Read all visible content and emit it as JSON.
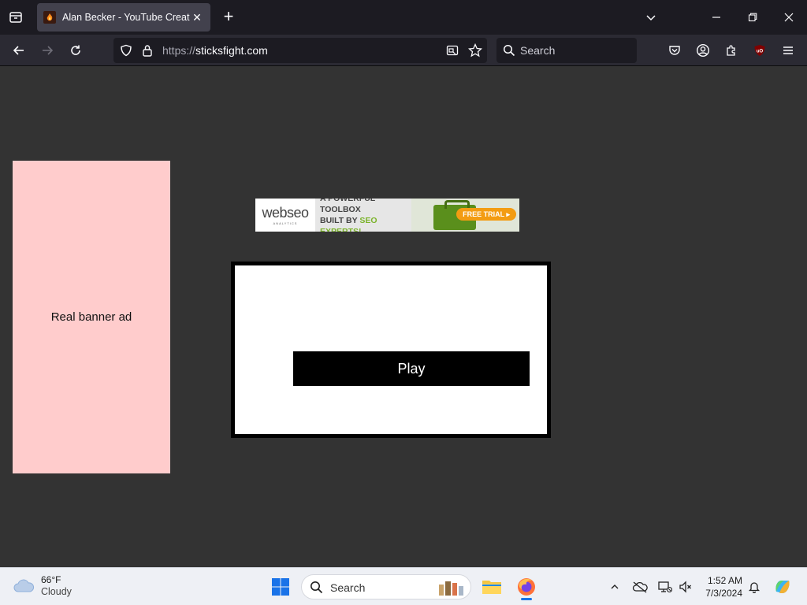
{
  "browser": {
    "tab": {
      "title": "Alan Becker - YouTube Creator"
    },
    "url": {
      "scheme": "https://",
      "host": "sticksfight.com"
    },
    "search": {
      "placeholder": "Search"
    }
  },
  "page": {
    "side_ad": {
      "label": "Real banner ad"
    },
    "top_ad": {
      "logo_main": "webseo",
      "logo_sub": "ANALYTICS",
      "line1": "A POWERFUL TOOLBOX",
      "line2_prefix": "BUILT BY ",
      "line2_highlight": "SEO EXPERTS!",
      "cta": "FREE TRIAL ▸"
    },
    "game": {
      "play_label": "Play"
    }
  },
  "taskbar": {
    "weather": {
      "temp": "66°F",
      "condition": "Cloudy"
    },
    "search_label": "Search",
    "clock": {
      "time": "1:52 AM",
      "date": "7/3/2024"
    }
  },
  "colors": {
    "page_bg": "#333333",
    "side_ad_bg": "#ffcccc",
    "play_bg": "#000000"
  }
}
